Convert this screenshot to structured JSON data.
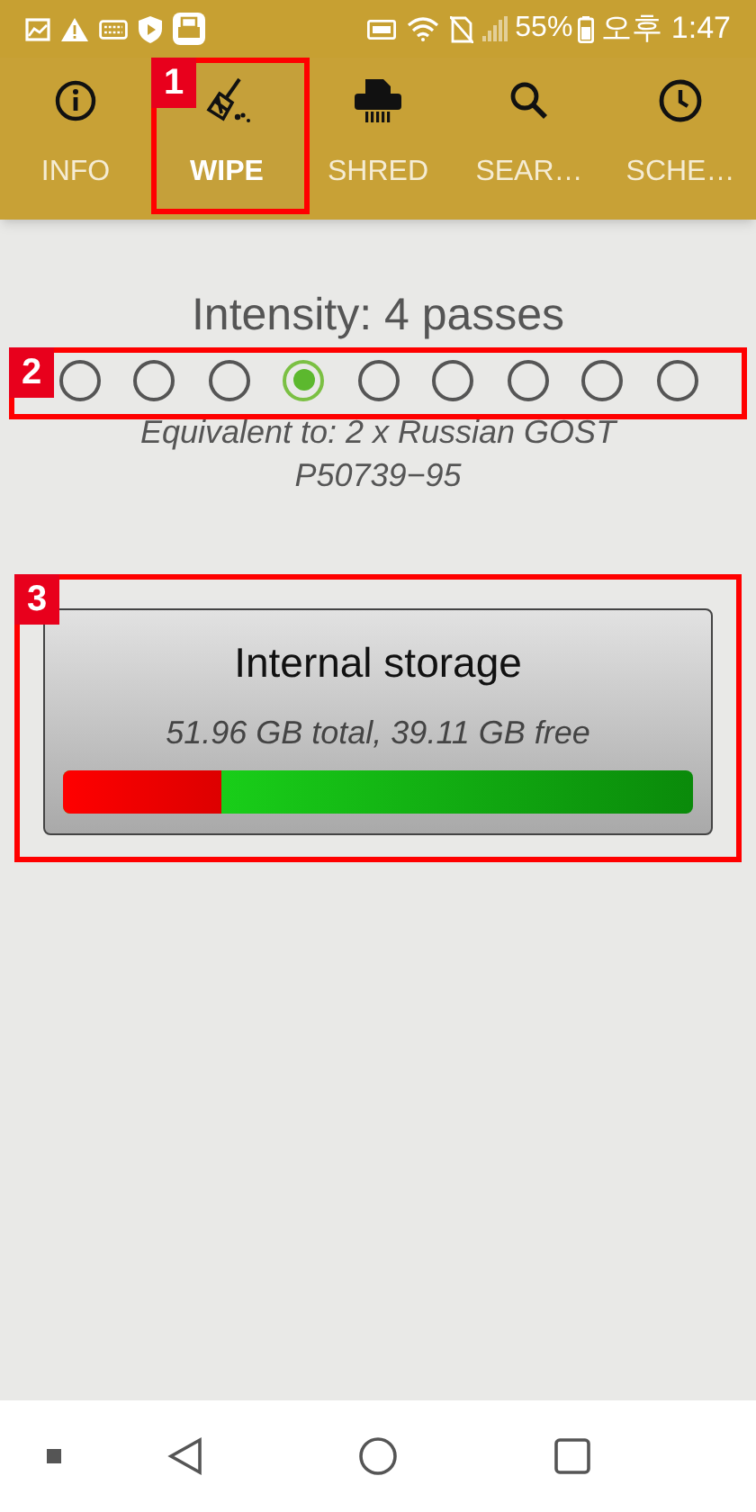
{
  "status_bar": {
    "battery": "55%",
    "time": "오후 1:47"
  },
  "tabs": [
    {
      "label": "INFO",
      "kind": "info",
      "selected": false
    },
    {
      "label": "WIPE",
      "kind": "wipe",
      "selected": true
    },
    {
      "label": "SHRED",
      "kind": "shred",
      "selected": false
    },
    {
      "label": "SEAR…",
      "kind": "search",
      "selected": false
    },
    {
      "label": "SCHE…",
      "kind": "schedule",
      "selected": false
    }
  ],
  "intensity": {
    "title": "Intensity: 4 passes",
    "options": [
      {
        "selected": false
      },
      {
        "selected": false
      },
      {
        "selected": false
      },
      {
        "selected": true
      },
      {
        "selected": false
      },
      {
        "selected": false
      },
      {
        "selected": false
      },
      {
        "selected": false
      },
      {
        "selected": false
      }
    ],
    "equivalent": "Equivalent to: 2 x Russian GOST P50739−95"
  },
  "storage": {
    "title": "Internal storage",
    "details": "51.96 GB total, 39.11 GB free",
    "level": 0.25
  },
  "annotations": [
    {
      "label": "1"
    },
    {
      "label": "2"
    },
    {
      "label": "3"
    }
  ]
}
